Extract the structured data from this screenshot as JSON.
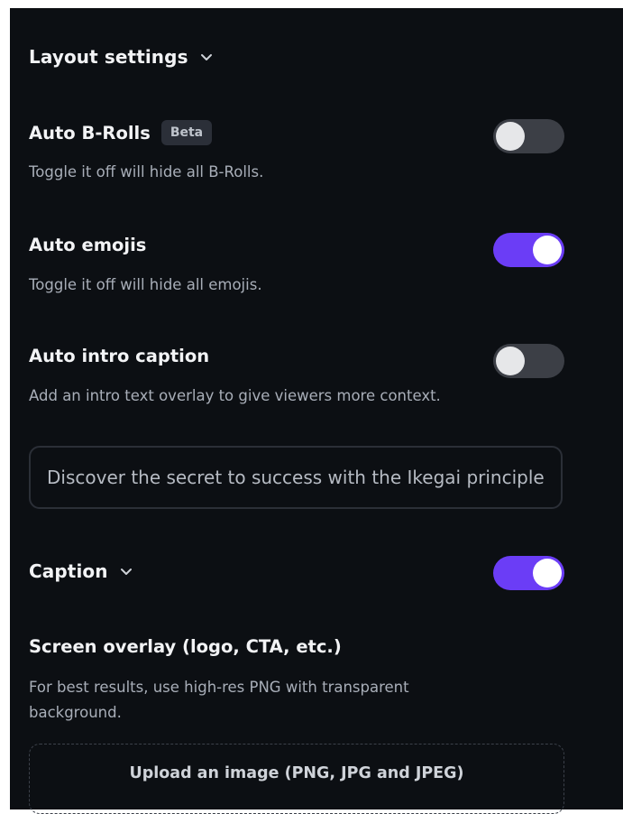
{
  "layout_settings": {
    "title": "Layout settings"
  },
  "auto_brolls": {
    "title": "Auto B-Rolls",
    "badge": "Beta",
    "description": "Toggle it off will hide all B-Rolls.",
    "enabled": false
  },
  "auto_emojis": {
    "title": "Auto emojis",
    "description": "Toggle it off will hide all emojis.",
    "enabled": true
  },
  "auto_intro_caption": {
    "title": "Auto intro caption",
    "description": "Add an intro text overlay to give viewers more context.",
    "enabled": false,
    "input_value": "Discover the secret to success with the Ikegai principle"
  },
  "caption": {
    "title": "Caption",
    "enabled": true
  },
  "screen_overlay": {
    "title": "Screen overlay (logo, CTA, etc.)",
    "description": "For best results, use high-res PNG with transparent background.",
    "upload_label": "Upload an image (PNG, JPG and JPEG)"
  },
  "colors": {
    "accent": "#6b3df6",
    "panel_bg": "#0c0f13",
    "toggle_off": "#3c3f46"
  },
  "icons": {
    "layout_chevron": "chevron-down-icon",
    "caption_chevron": "chevron-down-icon"
  }
}
